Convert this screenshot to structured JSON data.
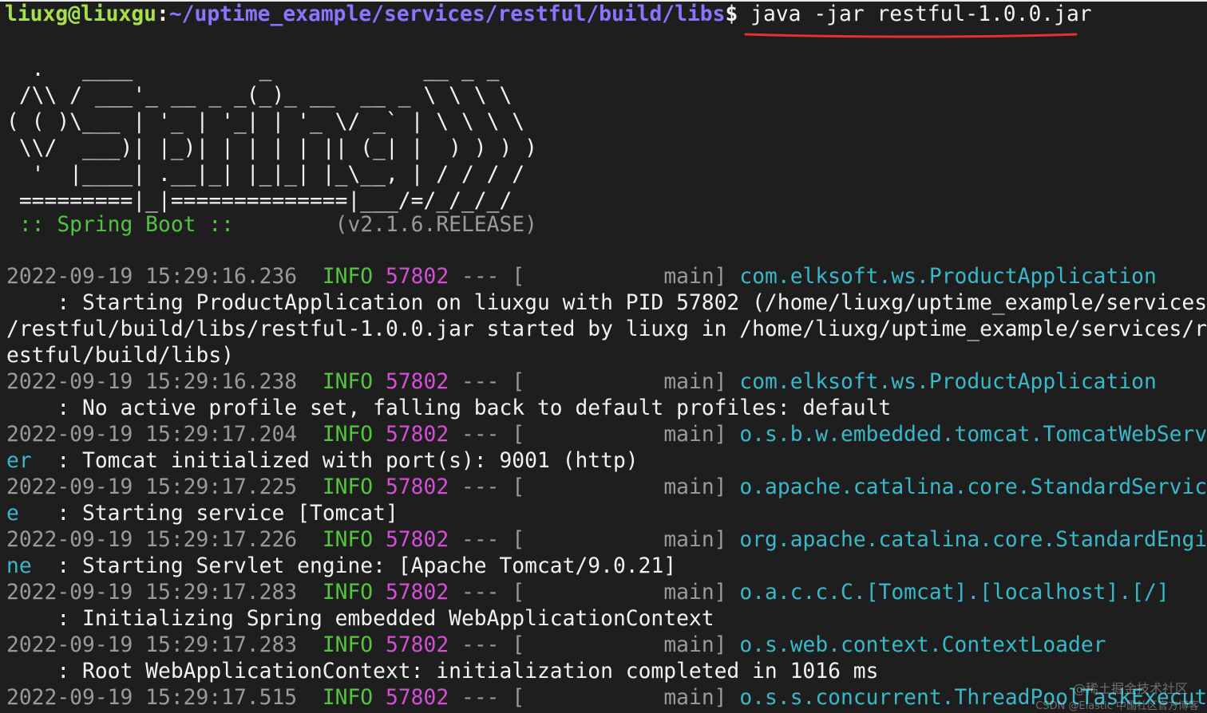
{
  "prompt": {
    "user_host": "liuxg@liuxgu",
    "colon": ":",
    "path": "~/uptime_example/services/restful/build/libs",
    "symbol": "$",
    "command": "java -jar restful-1.0.0.jar"
  },
  "banner": [
    "  .   ____          _            __ _ _",
    " /\\\\ / ___'_ __ _ _(_)_ __  __ _ \\ \\ \\ \\",
    "( ( )\\___ | '_ | '_| | '_ \\/ _` | \\ \\ \\ \\",
    " \\\\/  ___)| |_)| | | | | || (_| |  ) ) ) )",
    "  '  |____| .__|_| |_|_| |_\\__, | / / / /",
    " =========|_|==============|___/=/_/_/_/"
  ],
  "boot": {
    "label": " :: Spring Boot ::",
    "spacer": "        ",
    "version": "(v2.1.6.RELEASE)"
  },
  "logs": [
    {
      "timestamp": "2022-09-19 15:29:16.236",
      "level": "INFO",
      "pid": "57802",
      "sep": "---",
      "thread": "[           main]",
      "logger": "com.elksoft.ws.ProductApplication",
      "logger_wrap": "",
      "message": "    : Starting ProductApplication on liuxgu with PID 57802 (/home/liuxg/uptime_example/services",
      "message_cont": [
        "/restful/build/libs/restful-1.0.0.jar started by liuxg in /home/liuxg/uptime_example/services/r",
        "estful/build/libs)"
      ]
    },
    {
      "timestamp": "2022-09-19 15:29:16.238",
      "level": "INFO",
      "pid": "57802",
      "sep": "---",
      "thread": "[           main]",
      "logger": "com.elksoft.ws.ProductApplication",
      "logger_wrap": "",
      "message": "    : No active profile set, falling back to default profiles: default",
      "message_cont": []
    },
    {
      "timestamp": "2022-09-19 15:29:17.204",
      "level": "INFO",
      "pid": "57802",
      "sep": "---",
      "thread": "[           main]",
      "logger": "o.s.b.w.embedded.tomcat.TomcatWebServ",
      "logger_wrap": "er",
      "message": "  : Tomcat initialized with port(s): 9001 (http)",
      "message_cont": []
    },
    {
      "timestamp": "2022-09-19 15:29:17.225",
      "level": "INFO",
      "pid": "57802",
      "sep": "---",
      "thread": "[           main]",
      "logger": "o.apache.catalina.core.StandardServic",
      "logger_wrap": "e",
      "message": "   : Starting service [Tomcat]",
      "message_cont": []
    },
    {
      "timestamp": "2022-09-19 15:29:17.226",
      "level": "INFO",
      "pid": "57802",
      "sep": "---",
      "thread": "[           main]",
      "logger": "org.apache.catalina.core.StandardEngi",
      "logger_wrap": "ne",
      "message": "  : Starting Servlet engine: [Apache Tomcat/9.0.21]",
      "message_cont": []
    },
    {
      "timestamp": "2022-09-19 15:29:17.283",
      "level": "INFO",
      "pid": "57802",
      "sep": "---",
      "thread": "[           main]",
      "logger": "o.a.c.c.C.[Tomcat].[localhost].[/]",
      "logger_wrap": "",
      "message": "    : Initializing Spring embedded WebApplicationContext",
      "message_cont": []
    },
    {
      "timestamp": "2022-09-19 15:29:17.283",
      "level": "INFO",
      "pid": "57802",
      "sep": "---",
      "thread": "[           main]",
      "logger": "o.s.web.context.ContextLoader",
      "logger_wrap": "",
      "message": "    : Root WebApplicationContext: initialization completed in 1016 ms",
      "message_cont": []
    },
    {
      "timestamp": "2022-09-19 15:29:17.515",
      "level": "INFO",
      "pid": "57802",
      "sep": "---",
      "thread": "[           main]",
      "logger": "o.s.s.concurrent.ThreadPoolTaskExecut",
      "logger_wrap": "",
      "message": "",
      "message_cont": []
    }
  ],
  "watermark": {
    "line1": "@稀土掘金技术社区",
    "line2": "CSDN @Elastic 中国社区官方博客"
  },
  "colors": {
    "background": "#1e1e1e",
    "prompt_user": "#a8e04c",
    "prompt_path": "#8a75ff",
    "underline": "#e5322d",
    "level": "#53c63b",
    "pid": "#d54ed6",
    "logger": "#37b9c9"
  }
}
